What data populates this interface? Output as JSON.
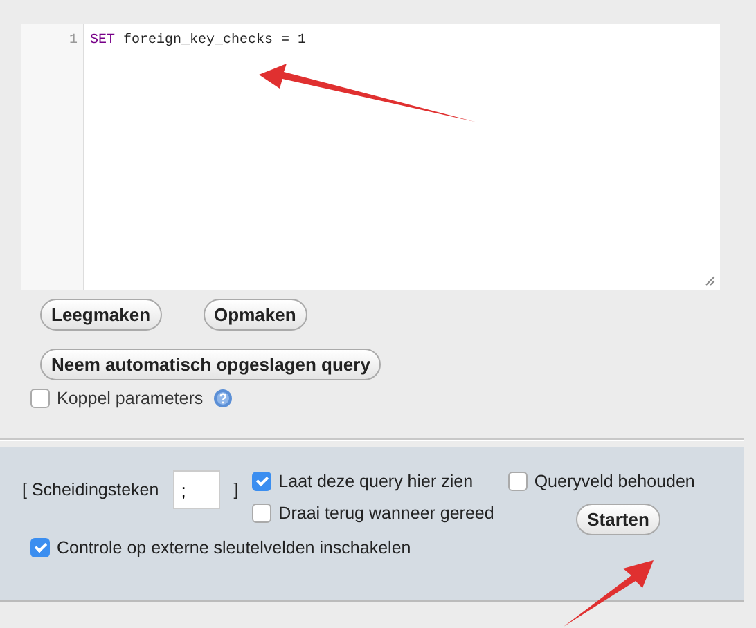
{
  "editor": {
    "lines": [
      {
        "number": "1",
        "tokens": [
          {
            "text": "SET",
            "kind": "keyword"
          },
          {
            "text": " foreign_key_checks = 1",
            "kind": "plain"
          }
        ]
      }
    ]
  },
  "buttons": [
    "Leegmaken",
    "Opmaken"
  ],
  "restore_button": "Neem automatisch opgeslagen query",
  "bind_parameters": {
    "label": "Koppel parameters",
    "checked": false
  },
  "options": {
    "delimiter_open": "[ Scheidingsteken",
    "delimiter_value": ";",
    "delimiter_close": "]",
    "checkboxes": [
      {
        "label": "Laat deze query hier zien",
        "checked": true
      },
      {
        "label": "Queryveld behouden",
        "checked": false
      },
      {
        "label": "Draai terug wanneer gereed",
        "checked": false
      },
      {
        "label": "Controle op externe sleutelvelden inschakelen",
        "checked": true
      }
    ],
    "submit": "Starten"
  }
}
